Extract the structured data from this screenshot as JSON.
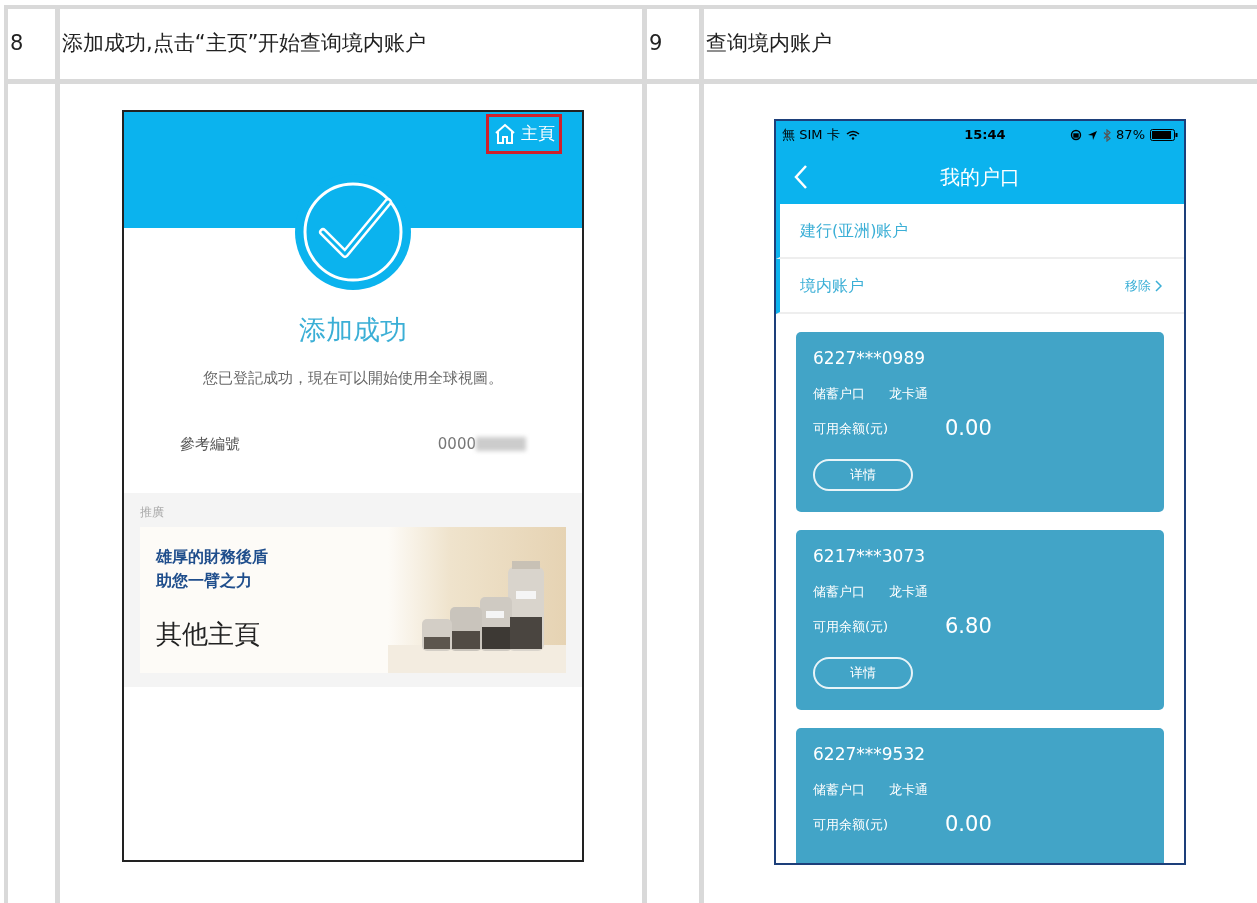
{
  "steps": [
    {
      "number": "8",
      "caption": "添加成功,点击“主页”开始查询境内账户"
    },
    {
      "number": "9",
      "caption": "查询境内账户"
    }
  ],
  "screen_8": {
    "home_link": {
      "label": "主頁",
      "highlighted": true
    },
    "title": "添加成功",
    "message": "您已登記成功，現在可以開始使用全球視圖。",
    "reference": {
      "label": "參考編號",
      "value": "0000"
    },
    "promo": {
      "heading": "推廣",
      "lines": [
        "雄厚的財務後盾",
        "助您一臂之力"
      ],
      "link": "其他主頁"
    }
  },
  "screen_9": {
    "status_bar": {
      "carrier": "無 SIM 卡",
      "time": "15:44",
      "battery": "87%"
    },
    "title": "我的户口",
    "sections": [
      {
        "label": "建行(亚洲)账户"
      },
      {
        "label": "境内账户",
        "action": "移除"
      }
    ],
    "accounts": [
      {
        "number": "6227***0989",
        "type": "储蓄户口",
        "product": "龙卡通",
        "balance_label": "可用余额(元)",
        "balance": "0.00",
        "button": "详情"
      },
      {
        "number": "6217***3073",
        "type": "储蓄户口",
        "product": "龙卡通",
        "balance_label": "可用余额(元)",
        "balance": "6.80",
        "button": "详情"
      },
      {
        "number": "6227***9532",
        "type": "储蓄户口",
        "product": "龙卡通",
        "balance_label": "可用余额(元)",
        "balance": "0.00"
      }
    ]
  }
}
